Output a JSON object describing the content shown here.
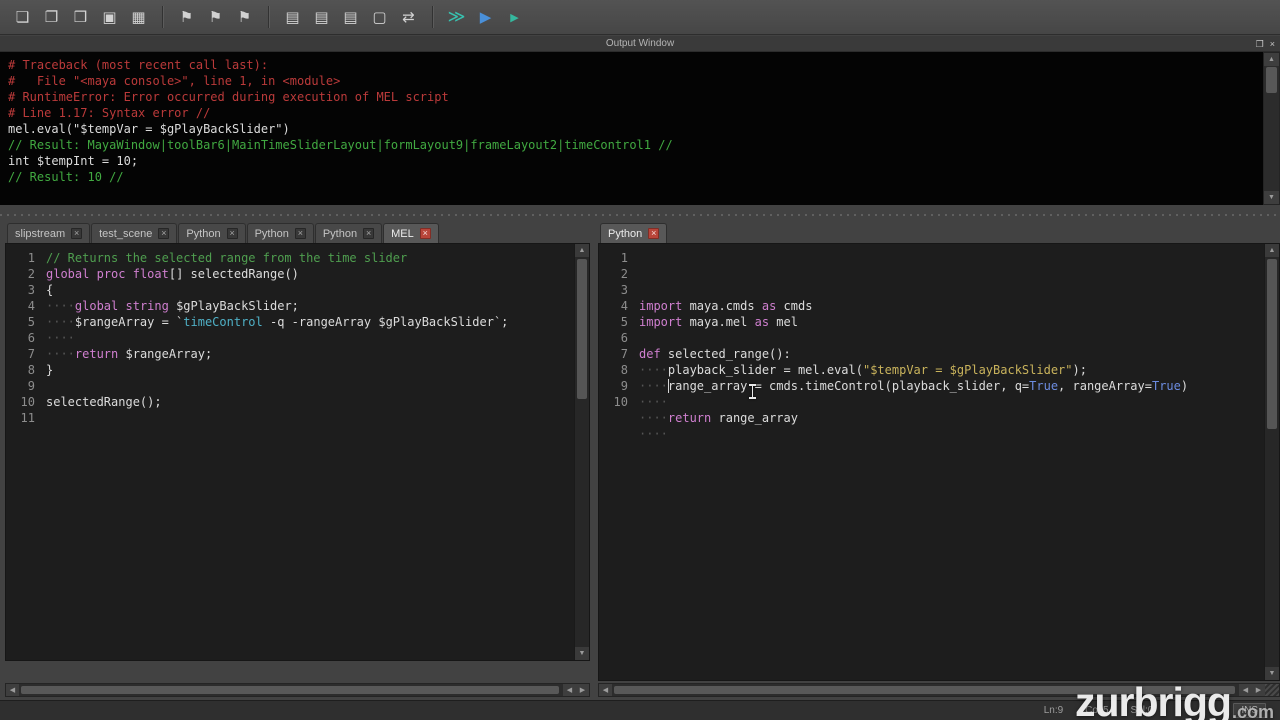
{
  "colors": {
    "error": "#bb3a3a",
    "result": "#41a941",
    "plain": "#dcdcdc",
    "comment": "#4f9e4f",
    "keyword": "#cf7fcf",
    "command": "#4fb0c6",
    "string": "#c9b35c",
    "builtin": "#6c8ce0",
    "whitespace": "#565656",
    "exec_all": "#38c2b0",
    "exec": "#4a90d9",
    "exec_sel": "#35b89e"
  },
  "icons": {
    "close": "×",
    "float": "❐",
    "up": "▲",
    "down": "▼",
    "left": "◀",
    "right": "▶"
  },
  "toolbar": {
    "items": [
      {
        "type": "btn",
        "name": "new-script",
        "icon": "new-document-icon",
        "glyph": "❏"
      },
      {
        "type": "btn",
        "name": "open-script",
        "icon": "open-folder-icon",
        "glyph": "❐"
      },
      {
        "type": "btn",
        "name": "import-script",
        "icon": "folder-import-icon",
        "glyph": "❒"
      },
      {
        "type": "btn",
        "name": "save-script",
        "icon": "floppy-disk-icon",
        "glyph": "▣"
      },
      {
        "type": "btn",
        "name": "save-script-as",
        "icon": "floppy-edit-icon",
        "glyph": "▦"
      },
      {
        "type": "sep"
      },
      {
        "type": "btn",
        "name": "marker-1",
        "icon": "flag-icon",
        "glyph": "⚑"
      },
      {
        "type": "btn",
        "name": "marker-2",
        "icon": "flag-icon",
        "glyph": "⚑"
      },
      {
        "type": "btn",
        "name": "marker-3",
        "icon": "flag-icon",
        "glyph": "⚑"
      },
      {
        "type": "sep"
      },
      {
        "type": "btn",
        "name": "show-history",
        "icon": "list-lines-icon",
        "glyph": "▤"
      },
      {
        "type": "btn",
        "name": "show-input",
        "icon": "list-lines-icon",
        "glyph": "▤"
      },
      {
        "type": "btn",
        "name": "show-all",
        "icon": "list-lines-icon",
        "glyph": "▤"
      },
      {
        "type": "btn",
        "name": "command-box",
        "icon": "box-icon",
        "glyph": "▢"
      },
      {
        "type": "btn",
        "name": "toggle-wrap",
        "icon": "swap-arrows-icon",
        "glyph": "⇄"
      },
      {
        "type": "sep"
      },
      {
        "type": "btn",
        "name": "execute-all",
        "icon": "double-play-icon",
        "glyph": "≫",
        "color": "exec_all",
        "size": 17
      },
      {
        "type": "btn",
        "name": "execute",
        "icon": "play-icon",
        "glyph": "▶",
        "color": "exec",
        "size": 15
      },
      {
        "type": "btn",
        "name": "execute-selected",
        "icon": "play-icon",
        "glyph": "▶",
        "color": "exec_sel",
        "size": 11
      }
    ]
  },
  "output": {
    "title": "Output Window",
    "lines": [
      {
        "cls": "err",
        "text": "# Traceback (most recent call last):"
      },
      {
        "cls": "err",
        "text": "#   File \"<maya console>\", line 1, in <module>"
      },
      {
        "cls": "err",
        "text": "# RuntimeError: Error occurred during execution of MEL script"
      },
      {
        "cls": "err",
        "text": "# Line 1.17: Syntax error //"
      },
      {
        "cls": "plain",
        "text": "mel.eval(\"$tempVar = $gPlayBackSlider\")"
      },
      {
        "cls": "res",
        "text": "// Result: MayaWindow|toolBar6|MainTimeSliderLayout|formLayout9|frameLayout2|timeControl1 //"
      },
      {
        "cls": "plain",
        "text": "int $tempInt = 10;"
      },
      {
        "cls": "res",
        "text": "// Result: 10 //"
      }
    ]
  },
  "left_editor": {
    "tabs": [
      {
        "label": "slipstream",
        "active": false,
        "close": "gray"
      },
      {
        "label": "test_scene",
        "active": false,
        "close": "gray"
      },
      {
        "label": "Python",
        "active": false,
        "close": "gray"
      },
      {
        "label": "Python",
        "active": false,
        "close": "gray"
      },
      {
        "label": "Python",
        "active": false,
        "close": "gray"
      },
      {
        "label": "MEL",
        "active": true,
        "close": "red"
      }
    ],
    "lines": [
      [
        [
          "c",
          "// Returns the selected range from the time slider"
        ]
      ],
      [
        [
          "k",
          "global"
        ],
        [
          "p",
          " "
        ],
        [
          "k",
          "proc"
        ],
        [
          "p",
          " "
        ],
        [
          "k",
          "float"
        ],
        [
          "p",
          "[] selectedRange()"
        ]
      ],
      [
        [
          "p",
          "{"
        ]
      ],
      [
        [
          "w",
          "····"
        ],
        [
          "k",
          "global"
        ],
        [
          "p",
          " "
        ],
        [
          "k",
          "string"
        ],
        [
          "p",
          " $gPlayBackSlider;"
        ]
      ],
      [
        [
          "w",
          "····"
        ],
        [
          "p",
          "$rangeArray = `"
        ],
        [
          "f",
          "timeControl"
        ],
        [
          "p",
          " -q -rangeArray $gPlayBackSlider`;"
        ]
      ],
      [
        [
          "w",
          "····"
        ]
      ],
      [
        [
          "w",
          "····"
        ],
        [
          "k",
          "return"
        ],
        [
          "p",
          " $rangeArray;"
        ]
      ],
      [
        [
          "p",
          "}"
        ]
      ],
      [],
      [
        [
          "p",
          "selectedRange();"
        ]
      ],
      []
    ]
  },
  "right_editor": {
    "tabs": [
      {
        "label": "Python",
        "active": true,
        "close": "red"
      }
    ],
    "lines": [
      [
        [
          "k",
          "import"
        ],
        [
          "p",
          " maya.cmds "
        ],
        [
          "k",
          "as"
        ],
        [
          "p",
          " cmds"
        ]
      ],
      [
        [
          "k",
          "import"
        ],
        [
          "p",
          " maya.mel "
        ],
        [
          "k",
          "as"
        ],
        [
          "p",
          " mel"
        ]
      ],
      [],
      [
        [
          "k",
          "def"
        ],
        [
          "p",
          " selected_range():"
        ]
      ],
      [
        [
          "w",
          "····"
        ],
        [
          "p",
          "playback_slider = mel.eval("
        ],
        [
          "s",
          "\"$tempVar = $gPlayBackSlider\""
        ],
        [
          "p",
          ");"
        ]
      ],
      [
        [
          "w",
          "····"
        ],
        [
          "p",
          "range_array = cmds.timeControl(playback_slider, q="
        ],
        [
          "b",
          "True"
        ],
        [
          "p",
          ", rangeArray="
        ],
        [
          "b",
          "True"
        ],
        [
          "p",
          ")"
        ]
      ],
      [
        [
          "w",
          "····"
        ]
      ],
      [
        [
          "w",
          "····"
        ],
        [
          "k",
          "return"
        ],
        [
          "p",
          " range_array"
        ]
      ],
      [
        [
          "w",
          "····"
        ]
      ],
      []
    ],
    "caret": {
      "line": 9,
      "col": 5
    }
  },
  "status": {
    "ln": "Ln:9",
    "col": "Col:5",
    "sel": "Sel:0",
    "mode": "INS"
  },
  "watermark": {
    "name": "zurbrigg",
    "tld": ".com"
  }
}
